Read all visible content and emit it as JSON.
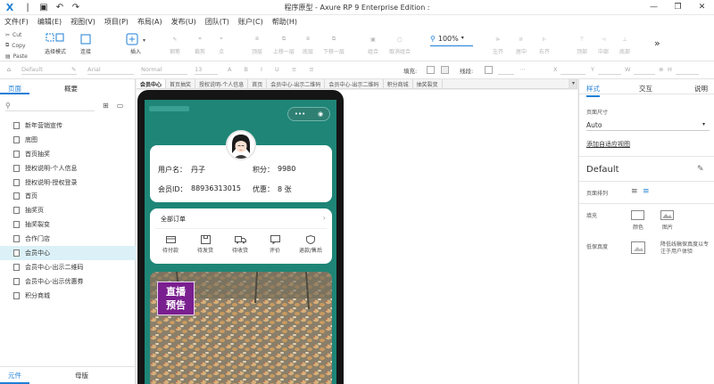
{
  "titlebar": {
    "title": "程序原型 - Axure RP 9 Enterprise Edition :"
  },
  "menu": [
    "文件(F)",
    "编辑(E)",
    "视图(V)",
    "项目(P)",
    "布局(A)",
    "发布(U)",
    "团队(T)",
    "账户(C)",
    "帮助(H)"
  ],
  "clipboard": {
    "cut": "Cut",
    "copy": "Copy",
    "paste": "Paste"
  },
  "toolbar": {
    "select_mode": "选择模式",
    "connect": "连接",
    "insert": "插入",
    "pen": "钢笔",
    "crop": "裁剪",
    "point": "点",
    "top_layer": "顶层",
    "up_layer": "上移一层",
    "bottom_layer": "底层",
    "down_layer": "下移一层",
    "group": "组合",
    "ungroup": "取消组合",
    "zoom": "100%",
    "align_left": "左齐",
    "align_center": "居中",
    "align_right": "右齐",
    "top": "顶部",
    "middle": "中部",
    "bottom": "底部"
  },
  "formatbar": {
    "style": "Default",
    "font": "Arial",
    "weight": "Normal",
    "size": "13",
    "fill_label": "填充:",
    "line_label": "线段:",
    "x": "X",
    "y": "Y",
    "w": "W",
    "h": "H"
  },
  "leftpanel": {
    "tab_pages": "页面",
    "tab_outline": "概要",
    "pages": [
      "新年营销宣传",
      "底图",
      "首页抽奖",
      "授权说明-个人信息",
      "授权说明-授权登录",
      "首页",
      "抽奖页",
      "抽奖裂变",
      "合作门店",
      "会员中心",
      "会员中心-出示二维码",
      "会员中心-出示优惠券",
      "积分商城"
    ],
    "selected_page": "会员中心",
    "tab_widgets": "元件",
    "tab_masters": "母版"
  },
  "doctabs": [
    "会员中心",
    "首页抽奖",
    "授权说明-个人信息",
    "首页",
    "会员中心-出示二维码",
    "会员中心-出示二维码",
    "积分商城",
    "抽奖裂变"
  ],
  "phone": {
    "capsule_dots": "•••",
    "capsule_target": "◉",
    "username_label": "用户名：",
    "username": "丹子",
    "points_label": "积分：",
    "points": "9980",
    "member_id_label": "会员ID：",
    "member_id": "88936313015",
    "coupons_label": "优惠：",
    "coupons": "8 张",
    "all_orders": "全部订单",
    "order_states": [
      "待付款",
      "待发货",
      "待收货",
      "评价",
      "退款/售后"
    ],
    "live_badge_line1": "直播",
    "live_badge_line2": "预告"
  },
  "rightpanel": {
    "tab_style": "样式",
    "tab_interact": "交互",
    "tab_notes": "说明",
    "page_size_label": "页面尺寸",
    "page_size": "Auto",
    "add_adaptive": "添加自适应视图",
    "default": "Default",
    "page_align_label": "页面排列",
    "fill_label": "填充",
    "fill_color": "颜色",
    "fill_image": "图片",
    "low_fidelity_label": "低保真度",
    "low_fidelity_desc": "降低线稿保真度以专注于用户体验"
  },
  "colors": {
    "accent": "#1e7fd6",
    "phone_bg": "#1e8577",
    "selected_row": "#dbf1f7"
  }
}
